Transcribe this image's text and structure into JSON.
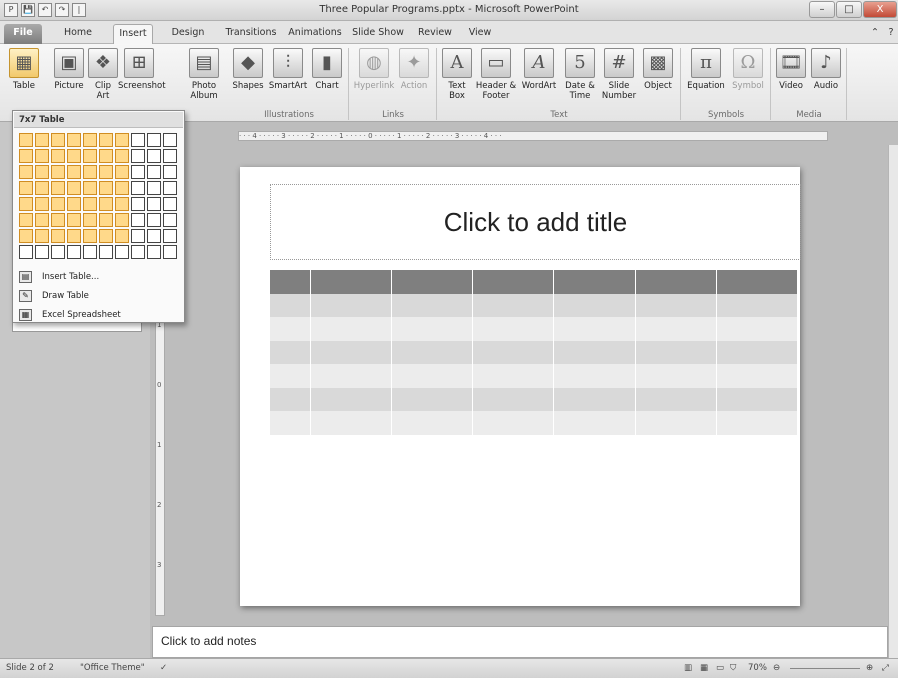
{
  "window": {
    "title": "Three Popular Programs.pptx - Microsoft PowerPoint",
    "controls": [
      "–",
      "□",
      "X"
    ]
  },
  "quick_access": [
    "P",
    "💾",
    "↶",
    "↷",
    "|"
  ],
  "tabs": [
    {
      "label": "File",
      "active": false
    },
    {
      "label": "Home",
      "active": false
    },
    {
      "label": "Insert",
      "active": true
    },
    {
      "label": "Design",
      "active": false
    },
    {
      "label": "Transitions",
      "active": false
    },
    {
      "label": "Animations",
      "active": false
    },
    {
      "label": "Slide Show",
      "active": false
    },
    {
      "label": "Review",
      "active": false
    },
    {
      "label": "View",
      "active": false
    }
  ],
  "ribbon": {
    "buttons": [
      {
        "label": "Table",
        "icon": "table-icon",
        "glyph": "▦",
        "selected": true,
        "disabled": false
      },
      {
        "label": "Picture",
        "icon": "picture-icon",
        "glyph": "▣",
        "selected": false,
        "disabled": false
      },
      {
        "label": "Clip Art",
        "icon": "clip-art-icon",
        "glyph": "❖",
        "selected": false,
        "disabled": false
      },
      {
        "label": "Screenshot",
        "icon": "screenshot-icon",
        "glyph": "⊞",
        "selected": false,
        "disabled": false
      },
      {
        "label": "Photo Album",
        "icon": "photo-album-icon",
        "glyph": "▤",
        "selected": false,
        "disabled": false
      },
      {
        "label": "Shapes",
        "icon": "shapes-icon",
        "glyph": "◆",
        "selected": false,
        "disabled": false
      },
      {
        "label": "SmartArt",
        "icon": "smartart-icon",
        "glyph": "⫶",
        "selected": false,
        "disabled": false
      },
      {
        "label": "Chart",
        "icon": "chart-icon",
        "glyph": "▮",
        "selected": false,
        "disabled": false
      },
      {
        "label": "Hyperlink",
        "icon": "hyperlink-icon",
        "glyph": "◍",
        "selected": false,
        "disabled": true
      },
      {
        "label": "Action",
        "icon": "action-icon",
        "glyph": "✦",
        "selected": false,
        "disabled": true
      },
      {
        "label": "Text Box",
        "icon": "text-box-icon",
        "glyph": "A",
        "selected": false,
        "disabled": false
      },
      {
        "label": "Header & Footer",
        "icon": "header-footer-icon",
        "glyph": "▭",
        "selected": false,
        "disabled": false
      },
      {
        "label": "WordArt",
        "icon": "wordart-icon",
        "glyph": "𝐴",
        "selected": false,
        "disabled": false
      },
      {
        "label": "Date & Time",
        "icon": "date-time-icon",
        "glyph": "5",
        "selected": false,
        "disabled": false
      },
      {
        "label": "Slide Number",
        "icon": "slide-number-icon",
        "glyph": "#",
        "selected": false,
        "disabled": false
      },
      {
        "label": "Object",
        "icon": "object-icon",
        "glyph": "▩",
        "selected": false,
        "disabled": false
      },
      {
        "label": "Equation",
        "icon": "equation-icon",
        "glyph": "π",
        "selected": false,
        "disabled": false
      },
      {
        "label": "Symbol",
        "icon": "symbol-icon",
        "glyph": "Ω",
        "selected": false,
        "disabled": true
      },
      {
        "label": "Video",
        "icon": "video-icon",
        "glyph": "🎞",
        "selected": false,
        "disabled": false
      },
      {
        "label": "Audio",
        "icon": "audio-icon",
        "glyph": "♪",
        "selected": false,
        "disabled": false
      }
    ],
    "groups": [
      "Illustrations",
      "Links",
      "Text",
      "Symbols",
      "Media"
    ]
  },
  "table_dropdown": {
    "header": "7x7 Table",
    "grid_cols": 10,
    "grid_rows": 8,
    "selected_cols": 7,
    "selected_rows": 7,
    "items": [
      {
        "label": "Insert Table...",
        "icon": "insert-table-icon"
      },
      {
        "label": "Draw Table",
        "icon": "draw-table-icon"
      },
      {
        "label": "Excel Spreadsheet",
        "icon": "excel-spreadsheet-icon"
      }
    ]
  },
  "ruler": {
    "horizontal": "· · · 4 · · · · · 3 · · · · · 2 · · · · · 1 · · · · · 0 · · · · · 1 · · · · · 2 · · · · · 3 · · · · · 4 · · ·",
    "vertical": [
      "1",
      "0",
      "1",
      "2",
      "3"
    ]
  },
  "slide": {
    "title_placeholder": "Click to add title",
    "table": {
      "rows": 7,
      "cols": 7
    }
  },
  "notes": {
    "placeholder": "Click to add notes"
  },
  "statusbar": {
    "slide": "Slide 2 of 2",
    "theme": "\"Office Theme\"",
    "zoom": "70%"
  }
}
